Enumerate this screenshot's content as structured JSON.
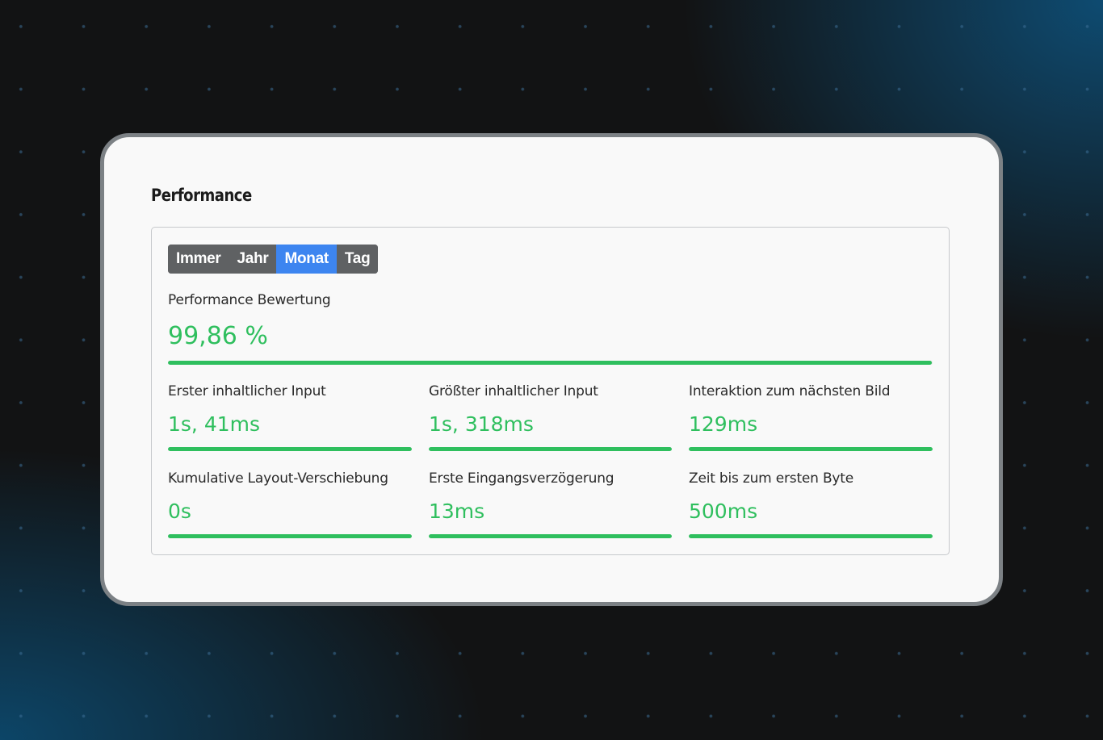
{
  "colors": {
    "accent_green": "#2fbf5e",
    "segment_active": "#3d85f0",
    "segment_inactive": "#5f6163"
  },
  "section": {
    "title": "Performance"
  },
  "period_tabs": {
    "items": [
      "Immer",
      "Jahr",
      "Monat",
      "Tag"
    ],
    "selected": "Monat"
  },
  "score": {
    "label": "Performance Bewertung",
    "value": "99,86 %",
    "progress": 0.9986
  },
  "metrics": [
    {
      "label": "Erster inhaltlicher Input",
      "value": "1s, 41ms",
      "progress": 1.0
    },
    {
      "label": "Größter inhaltlicher Input",
      "value": "1s, 318ms",
      "progress": 1.0
    },
    {
      "label": "Interaktion zum nächsten Bild",
      "value": "129ms",
      "progress": 1.0
    },
    {
      "label": "Kumulative Layout-Verschiebung",
      "value": "0s",
      "progress": 1.0
    },
    {
      "label": "Erste Eingangsverzögerung",
      "value": "13ms",
      "progress": 1.0
    },
    {
      "label": "Zeit bis zum ersten Byte",
      "value": "500ms",
      "progress": 1.0
    }
  ]
}
